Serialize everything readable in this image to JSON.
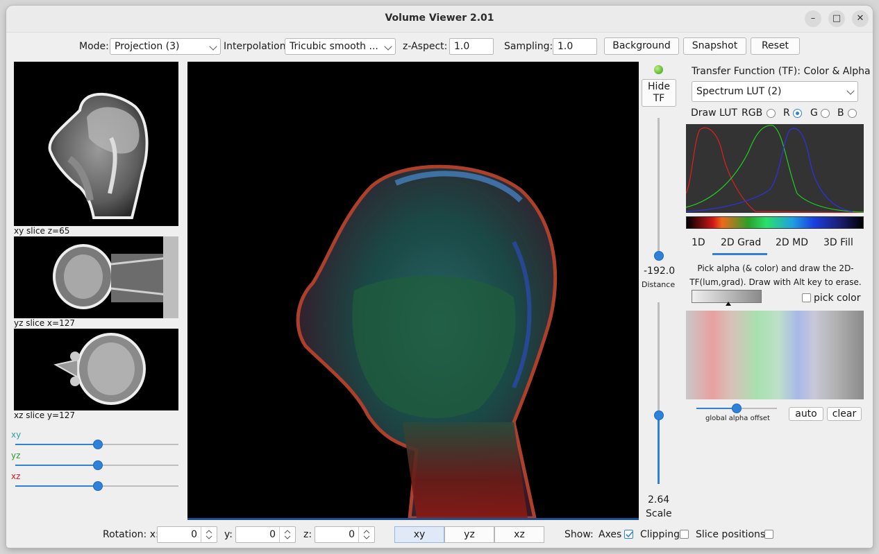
{
  "window": {
    "title": "Volume Viewer 2.01",
    "minimize": "–",
    "maximize": "□",
    "close": "✕"
  },
  "toolbar": {
    "mode_label": "Mode:",
    "mode_value": "Projection (3)",
    "interp_label": "Interpolation:",
    "interp_value": "Tricubic smooth ...",
    "zaspect_label": "z-Aspect:",
    "zaspect_value": "1.0",
    "sampling_label": "Sampling:",
    "sampling_value": "1.0",
    "background": "Background",
    "snapshot": "Snapshot",
    "reset": "Reset"
  },
  "slices": {
    "xy_caption": "xy slice  z=65",
    "yz_caption": "yz slice  x=127",
    "xz_caption": "xz slice  y=127",
    "slider_xy": "xy",
    "slider_yz": "yz",
    "slider_xz": "xz",
    "xy_pos": 0.5,
    "yz_pos": 0.5,
    "xz_pos": 0.5
  },
  "center": {
    "hide_tf": "Hide TF",
    "distance_value": "-192.0",
    "distance_label": "Distance",
    "scale_value": "2.64",
    "scale_label": "Scale"
  },
  "tf": {
    "title": "Transfer Function (TF): Color & Alpha",
    "lut_value": "Spectrum LUT (2)",
    "draw_lut": "Draw LUT",
    "rgb": "RGB",
    "r": "R",
    "g": "G",
    "b": "B",
    "tabs": [
      "1D",
      "2D Grad",
      "2D MD",
      "3D Fill"
    ],
    "instructions": "Pick alpha (& color) and draw the 2D-TF(lum,grad). Draw with Alt key to erase.",
    "pick_color": "pick color",
    "alpha_offset_label": "global alpha offset",
    "auto": "auto",
    "clear": "clear"
  },
  "bottom": {
    "rotation_label": "Rotation: x:",
    "rot_x": "0",
    "y_label": "y:",
    "rot_y": "0",
    "z_label": "z:",
    "rot_z": "0",
    "views": [
      "xy",
      "yz",
      "xz"
    ],
    "show_label": "Show:",
    "axes": "Axes",
    "clipping": "Clipping",
    "slice_positions": "Slice positions"
  }
}
